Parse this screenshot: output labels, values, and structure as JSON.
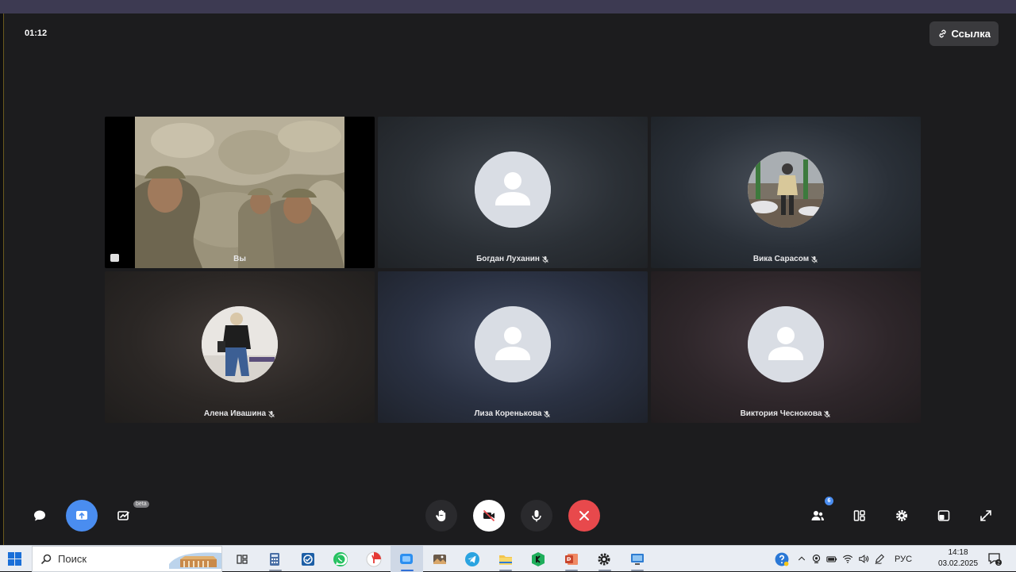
{
  "meeting": {
    "timer": "01:12",
    "link_label": "Ссылка"
  },
  "participants": [
    {
      "name": "Вы",
      "type": "video",
      "muted": false
    },
    {
      "name": "Богдан Луханин",
      "type": "placeholder",
      "muted": true
    },
    {
      "name": "Вика Сарасом",
      "type": "photo",
      "muted": true
    },
    {
      "name": "Алена Ивашина",
      "type": "photo",
      "muted": true
    },
    {
      "name": "Лиза Коренькова",
      "type": "placeholder",
      "muted": true
    },
    {
      "name": "Виктория Чеснокова",
      "type": "placeholder",
      "muted": true
    }
  ],
  "controls": {
    "left": [
      "chat-icon",
      "screen-share-icon",
      "whiteboard-icon"
    ],
    "whiteboard_badge": "beta",
    "center": [
      "raise-hand-icon",
      "camera-off-icon",
      "microphone-icon",
      "hang-up-icon"
    ],
    "right": [
      "participants-icon",
      "layout-icon",
      "settings-icon",
      "pip-icon",
      "fullscreen-icon"
    ],
    "participants_count": "6"
  },
  "taskbar": {
    "search_placeholder": "Поиск",
    "apps": [
      "task-view-icon",
      "calculator-icon",
      "app-icon",
      "whatsapp-icon",
      "yandex-browser-icon",
      "meeting-app-icon",
      "gallery-icon",
      "telegram-icon",
      "file-explorer-icon",
      "kaspersky-icon",
      "powerpoint-icon",
      "settings-icon",
      "remote-desktop-icon"
    ],
    "active_app_index": 5,
    "language": "РУС",
    "time": "14:18",
    "date": "03.02.2025",
    "notification_count": "2"
  },
  "colors": {
    "background": "#1c1c1e",
    "accent_blue": "#4a8df0",
    "hangup_red": "#e8494c"
  }
}
